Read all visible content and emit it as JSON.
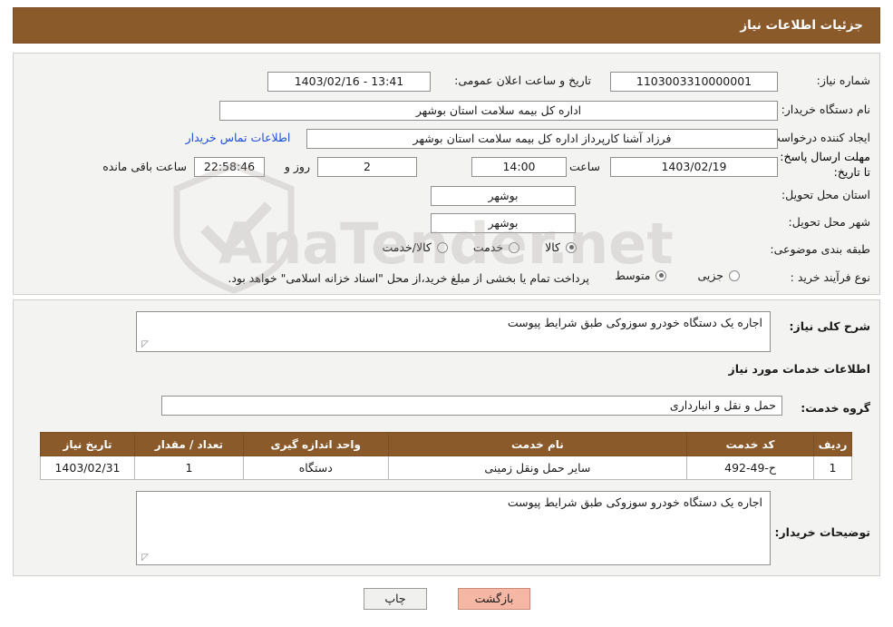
{
  "header": {
    "title": "جزئیات اطلاعات نیاز"
  },
  "form": {
    "need_number_label": "شماره نیاز:",
    "need_number_value": "1103003310000001",
    "announce_datetime_label": "تاریخ و ساعت اعلان عمومی:",
    "announce_datetime_value": "13:41 - 1403/02/16",
    "buyer_org_label": "نام دستگاه خریدار:",
    "buyer_org_value": "اداره کل بیمه سلامت استان بوشهر",
    "requester_label": "ایجاد کننده درخواست:",
    "requester_value": "فرزاد آشنا کارپرداز اداره کل بیمه سلامت استان بوشهر",
    "buyer_contact_label": "اطلاعات تماس خریدار",
    "deadline_label": "مهلت ارسال پاسخ: تا تاریخ:",
    "deadline_date": "1403/02/19",
    "deadline_hour_label": "ساعت",
    "deadline_hour": "14:00",
    "remaining_days": "2",
    "remaining_days_label": "روز و",
    "remaining_time": "22:58:46",
    "remaining_suffix": "ساعت باقی مانده",
    "province_label": "استان محل تحویل:",
    "province_value": "بوشهر",
    "city_label": "شهر محل تحویل:",
    "city_value": "بوشهر",
    "category_label": "طبقه بندی موضوعی:",
    "category_options": [
      {
        "label": "کالا",
        "checked": true
      },
      {
        "label": "خدمت",
        "checked": false
      },
      {
        "label": "کالا/خدمت",
        "checked": false
      }
    ],
    "process_label": "نوع فرآیند خرید :",
    "process_options": [
      {
        "label": "جزیی",
        "checked": false
      },
      {
        "label": "متوسط",
        "checked": true
      }
    ],
    "payment_note": "پرداخت تمام یا بخشی از مبلغ خرید،از محل \"اسناد خزانه اسلامی\" خواهد بود."
  },
  "description": {
    "general_need_label": "شرح کلی نیاز:",
    "general_need_value": "اجاره یک دستگاه خودرو سوزوکی طبق شرایط پیوست",
    "services_info_title": "اطلاعات خدمات مورد نیاز",
    "service_group_label": "گروه خدمت:",
    "service_group_value": "حمل و نقل و انبارداری",
    "buyer_notes_label": "توضیحات خریدار:",
    "buyer_notes_value": "اجاره یک دستگاه خودرو سوزوکی طبق شرایط پیوست"
  },
  "table": {
    "headers": [
      "ردیف",
      "کد خدمت",
      "نام خدمت",
      "واحد اندازه گیری",
      "تعداد / مقدار",
      "تاریخ نیاز"
    ],
    "rows": [
      {
        "row": "1",
        "code": "ح-49-492",
        "name": "سایر حمل ونقل زمینی",
        "unit": "دستگاه",
        "qty": "1",
        "date": "1403/02/31"
      }
    ]
  },
  "footer": {
    "print_label": "چاپ",
    "back_label": "بازگشت"
  },
  "watermark": {
    "text": "AnaTender.net"
  },
  "colors": {
    "header_brown": "#8a5a2b",
    "link_blue": "#1d4fd8",
    "back_button": "#f6b8a4"
  }
}
